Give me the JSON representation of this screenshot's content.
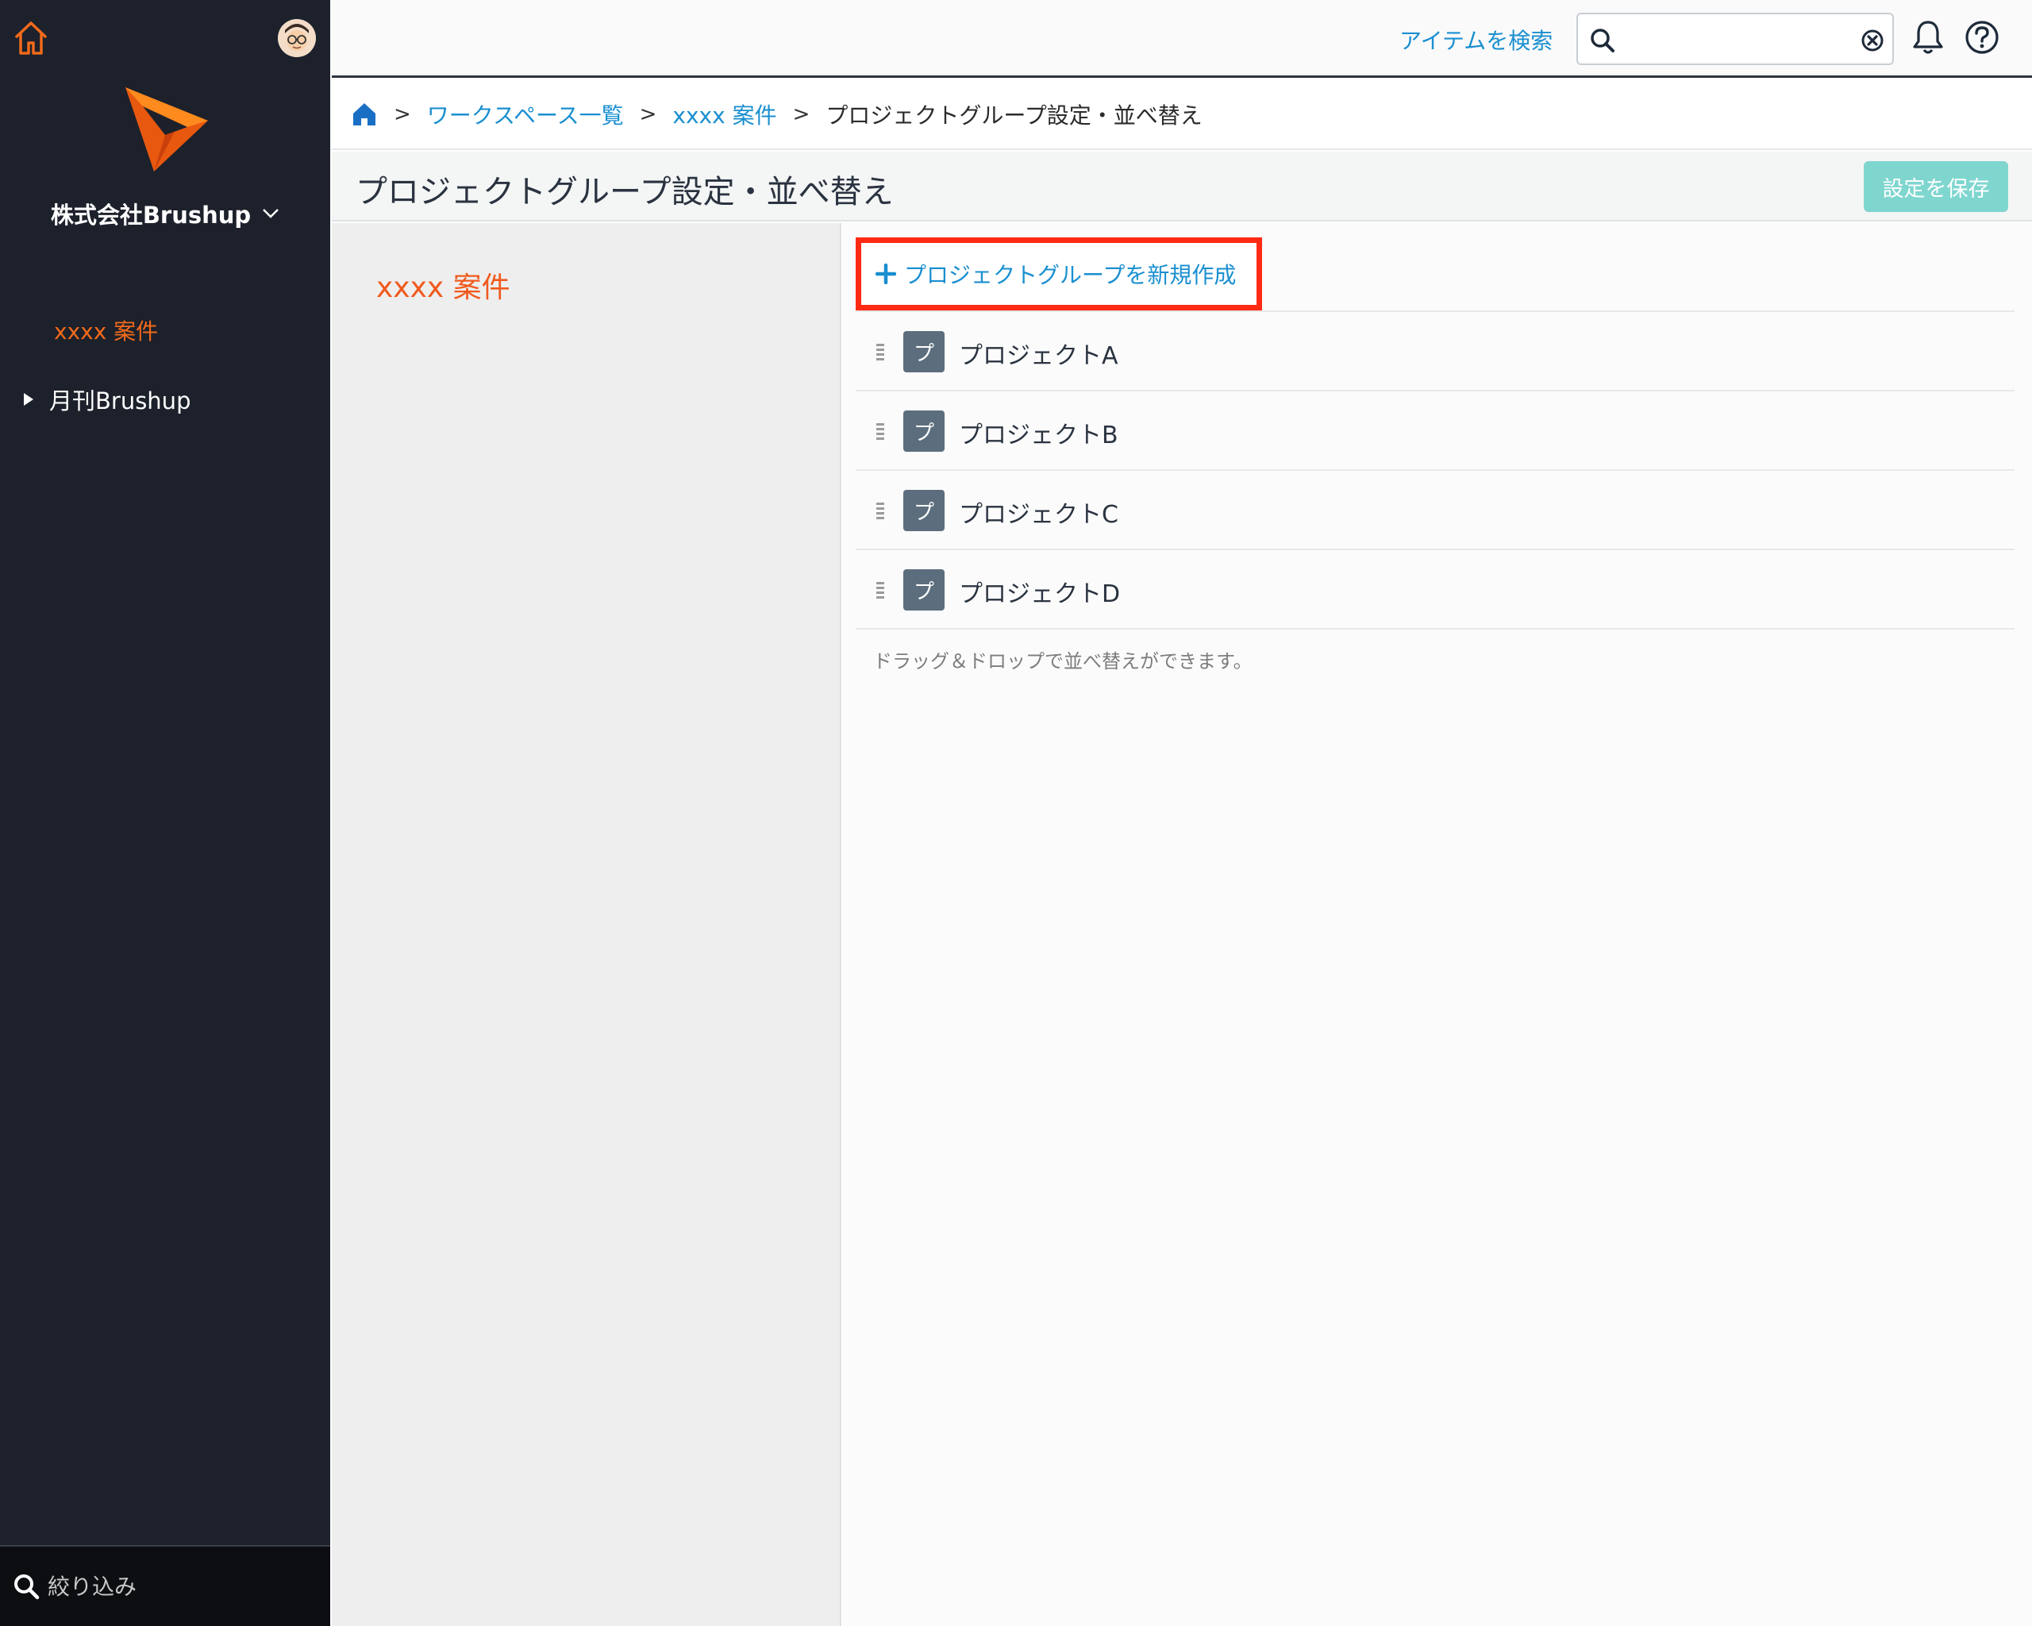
{
  "sidebar": {
    "company": "株式会社Brushup",
    "active_workspace": "xxxx 案件",
    "items": [
      {
        "label": "月刊Brushup"
      }
    ],
    "filter_placeholder": "絞り込み"
  },
  "topbar": {
    "search_label": "アイテムを検索",
    "search_value": ""
  },
  "breadcrumb": {
    "items": [
      "ワークスペース一覧",
      "xxxx 案件"
    ],
    "current": "プロジェクトグループ設定・並べ替え",
    "separator": ">"
  },
  "page": {
    "title": "プロジェクトグループ設定・並べ替え",
    "save_label": "設定を保存"
  },
  "left_panel": {
    "workspace": "xxxx 案件"
  },
  "main": {
    "create_label": "プロジェクトグループを新規作成",
    "projects": [
      {
        "badge": "プ",
        "name": "プロジェクトA"
      },
      {
        "badge": "プ",
        "name": "プロジェクトB"
      },
      {
        "badge": "プ",
        "name": "プロジェクトC"
      },
      {
        "badge": "プ",
        "name": "プロジェクトD"
      }
    ],
    "hint": "ドラッグ＆ドロップで並べ替えができます。"
  },
  "colors": {
    "sidebar_bg": "#1c212b",
    "accent_orange": "#f26a1b",
    "link_blue": "#1a8fd0",
    "save_button": "#7fd6cf",
    "highlight_red": "#ff2a14",
    "badge_bg": "#5c6e7e"
  },
  "icons": {
    "sidebar": [
      "home-icon",
      "avatar",
      "brand-logo",
      "chevron-down-icon",
      "caret-right-icon",
      "search-icon"
    ],
    "topbar": [
      "search-icon",
      "clear-icon",
      "bell-icon",
      "help-icon"
    ],
    "breadcrumb": [
      "home-icon"
    ],
    "main": [
      "plus-icon",
      "drag-handle-icon"
    ]
  }
}
